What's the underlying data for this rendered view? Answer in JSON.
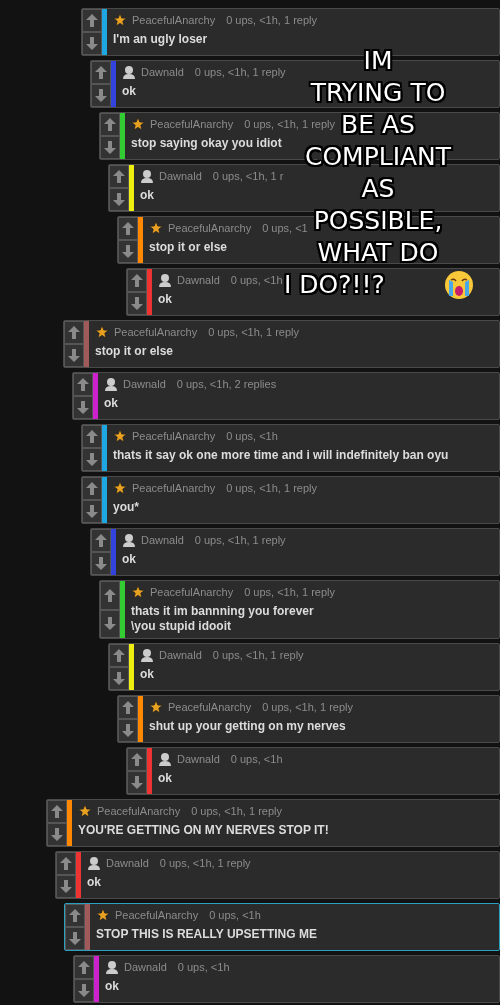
{
  "threads": [
    {
      "user": "PeacefulAnarchy",
      "kind": "mod",
      "meta": "0 ups, <1h, 1 reply",
      "text": "I'm an ugly loser",
      "color": "#1ea7e0",
      "highlighted": false,
      "children": [
        {
          "user": "Dawnald",
          "kind": "user",
          "meta": "0 ups, <1h, 1 reply",
          "text": "ok",
          "color": "#3344dd",
          "highlighted": false,
          "children": [
            {
              "user": "PeacefulAnarchy",
              "kind": "mod",
              "meta": "0 ups, <1h, 1 reply",
              "text": "stop saying okay you idiot",
              "color": "#33cc33",
              "highlighted": false,
              "children": [
                {
                  "user": "Dawnald",
                  "kind": "user",
                  "meta": "0 ups, <1h, 1 r",
                  "text": "ok",
                  "color": "#eeee11",
                  "highlighted": false,
                  "children": [
                    {
                      "user": "PeacefulAnarchy",
                      "kind": "mod",
                      "meta": "0 ups, <1",
                      "text": "stop it or else",
                      "color": "#ff8800",
                      "highlighted": false,
                      "children": [
                        {
                          "user": "Dawnald",
                          "kind": "user",
                          "meta": "0 ups, <1h",
                          "text": "ok",
                          "color": "#ee3333",
                          "highlighted": false
                        }
                      ]
                    }
                  ]
                }
              ]
            }
          ]
        }
      ]
    },
    {
      "user": "PeacefulAnarchy",
      "kind": "mod",
      "meta": "0 ups, <1h, 1 reply",
      "text": "stop it or else",
      "color": "#a05a5a",
      "highlighted": false,
      "children": [
        {
          "user": "Dawnald",
          "kind": "user",
          "meta": "0 ups, <1h, 2 replies",
          "text": "ok",
          "color": "#cc22cc",
          "highlighted": false,
          "children": [
            {
              "user": "PeacefulAnarchy",
              "kind": "mod",
              "meta": "0 ups, <1h",
              "text": "thats it say ok one more time and i will indefinitely ban oyu",
              "color": "#1ea7e0",
              "highlighted": false
            },
            {
              "user": "PeacefulAnarchy",
              "kind": "mod",
              "meta": "0 ups, <1h, 1 reply",
              "text": "you*",
              "color": "#1ea7e0",
              "highlighted": false,
              "children": [
                {
                  "user": "Dawnald",
                  "kind": "user",
                  "meta": "0 ups, <1h, 1 reply",
                  "text": "ok",
                  "color": "#3344dd",
                  "highlighted": false,
                  "children": [
                    {
                      "user": "PeacefulAnarchy",
                      "kind": "mod",
                      "meta": "0 ups, <1h, 1 reply",
                      "text": "thats it im bannning you forever\n\\you stupid idooit",
                      "color": "#33cc33",
                      "highlighted": false,
                      "children": [
                        {
                          "user": "Dawnald",
                          "kind": "user",
                          "meta": "0 ups, <1h, 1 reply",
                          "text": "ok",
                          "color": "#eeee11",
                          "highlighted": false,
                          "children": [
                            {
                              "user": "PeacefulAnarchy",
                              "kind": "mod",
                              "meta": "0 ups, <1h, 1 reply",
                              "text": "shut up your getting on my nerves",
                              "color": "#ff8800",
                              "highlighted": false,
                              "children": [
                                {
                                  "user": "Dawnald",
                                  "kind": "user",
                                  "meta": "0 ups, <1h",
                                  "text": "ok",
                                  "color": "#ee3333",
                                  "highlighted": false
                                }
                              ]
                            }
                          ]
                        }
                      ]
                    }
                  ]
                }
              ]
            }
          ]
        }
      ]
    },
    {
      "user": "PeacefulAnarchy",
      "kind": "mod",
      "meta": "0 ups, <1h, 1 reply",
      "text": "YOU'RE GETTING ON MY NERVES STOP IT!",
      "color": "#ff8800",
      "highlighted": false,
      "children": [
        {
          "user": "Dawnald",
          "kind": "user",
          "meta": "0 ups, <1h, 1 reply",
          "text": "ok",
          "color": "#ee3333",
          "highlighted": false,
          "children": [
            {
              "user": "PeacefulAnarchy",
              "kind": "mod",
              "meta": "0 ups, <1h",
              "text": "STOP THIS IS REALLY UPSETTING ME",
              "color": "#a05a5a",
              "highlighted": true,
              "children": [
                {
                  "user": "Dawnald",
                  "kind": "user",
                  "meta": "0 ups, <1h",
                  "text": "ok",
                  "color": "#cc22cc",
                  "highlighted": false
                }
              ]
            }
          ]
        }
      ]
    }
  ],
  "caption_lines": [
    "IM",
    "TRYING TO",
    "BE AS",
    "COMPLIANT",
    "AS",
    "POSSIBLE,",
    "WHAT DO",
    "I DO?!!?"
  ]
}
